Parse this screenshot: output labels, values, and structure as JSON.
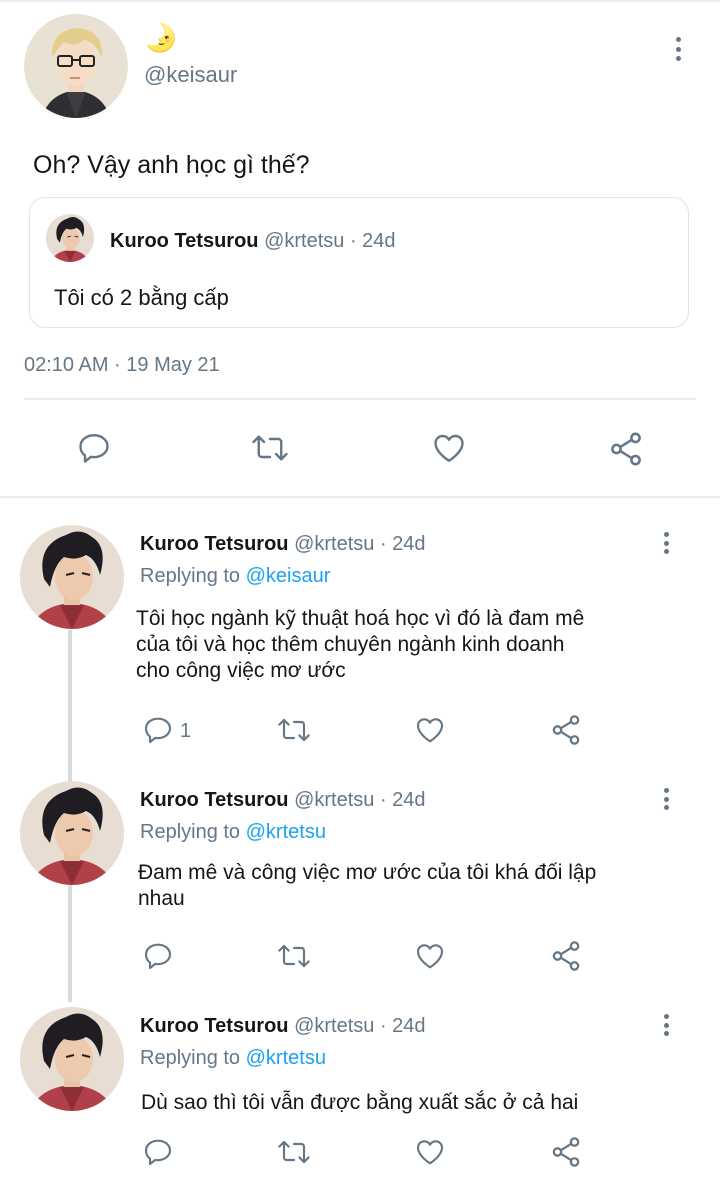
{
  "main_tweet": {
    "display_name": "🌛",
    "handle": "@keisaur",
    "text": "Oh? Vậy anh học gì thế?",
    "quote": {
      "name": "Kuroo Tetsurou",
      "handle": "@krtetsu",
      "age": "· 24d",
      "text": "Tôi có 2 bằng cấp"
    },
    "timestamp": "02:10 AM · 19 May 21"
  },
  "replies": [
    {
      "name": "Kuroo Tetsurou",
      "handle": "@krtetsu",
      "age": "· 24d",
      "replying_prefix": "Replying to",
      "replying_to": "@keisaur",
      "text_lines": [
        "Tôi học ngành kỹ thuật hoá học vì đó là đam mê",
        "của tôi và học thêm chuyên ngành kinh doanh",
        "cho công việc mơ ước"
      ],
      "reply_count": "1"
    },
    {
      "name": "Kuroo Tetsurou",
      "handle": "@krtetsu",
      "age": "· 24d",
      "replying_prefix": "Replying to",
      "replying_to": "@krtetsu",
      "text_lines": [
        "Đam mê và công việc mơ ước của tôi khá đối lập",
        "nhau"
      ],
      "reply_count": ""
    },
    {
      "name": "Kuroo Tetsurou",
      "handle": "@krtetsu",
      "age": "· 24d",
      "replying_prefix": "Replying to",
      "replying_to": "@krtetsu",
      "text_lines": [
        "Dù sao thì tôi vẫn được bằng xuất sắc ở cả hai"
      ],
      "reply_count": ""
    }
  ],
  "icons": [
    "reply-icon",
    "retweet-icon",
    "like-icon",
    "share-icon",
    "more-options-icon"
  ],
  "colors": {
    "accent": "#1da1f2",
    "muted": "#657786",
    "text": "#14171a",
    "divider": "#e6ecf0"
  }
}
